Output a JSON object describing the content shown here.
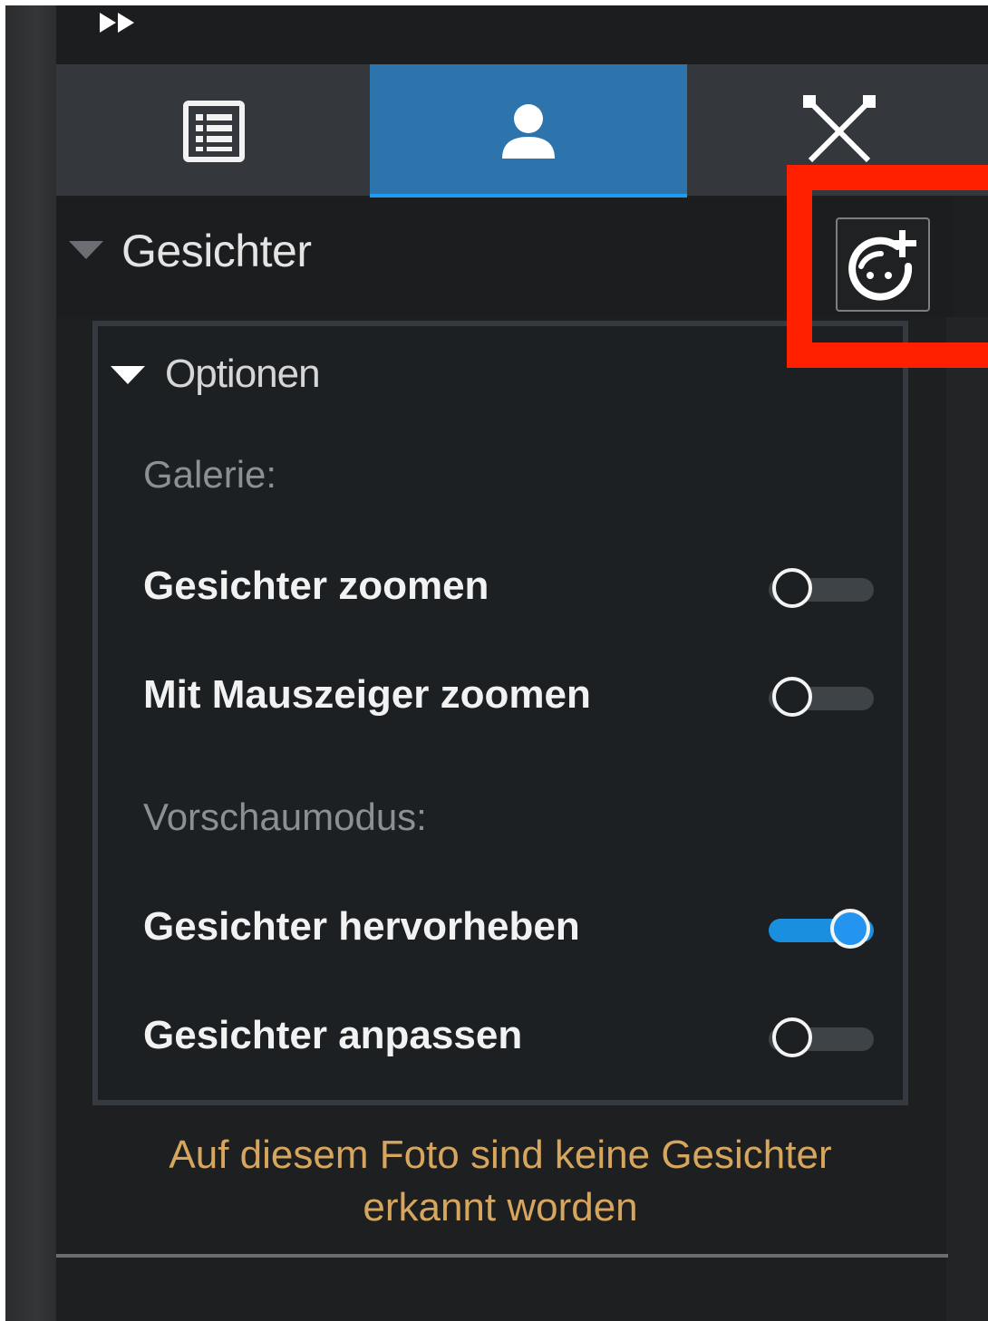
{
  "topbar": {
    "collapse_icon": "double-chevron-right-icon"
  },
  "tabs": [
    {
      "id": "info",
      "icon": "list-icon",
      "active": false
    },
    {
      "id": "people",
      "icon": "person-icon",
      "active": true
    },
    {
      "id": "geo",
      "icon": "cross-nodes-icon",
      "active": false
    }
  ],
  "section": {
    "title": "Gesichter",
    "add_button_icon": "add-face-icon",
    "highlight_color": "#ff2000"
  },
  "options": {
    "title": "Optionen",
    "gallery_label": "Galerie:",
    "preview_label": "Vorschaumodus:",
    "items": [
      {
        "label": "Gesichter zoomen",
        "on": false
      },
      {
        "label": "Mit Mauszeiger zoomen",
        "on": false
      },
      {
        "label": "Gesichter hervorheben",
        "on": true
      },
      {
        "label": "Gesichter anpassen",
        "on": false
      }
    ]
  },
  "message": {
    "line1": "Auf diesem Foto sind keine Gesichter",
    "line2": "erkannt worden",
    "color": "#d6a65e"
  },
  "colors": {
    "accent": "#1a8fe0",
    "active_tab": "#2d73ac"
  }
}
